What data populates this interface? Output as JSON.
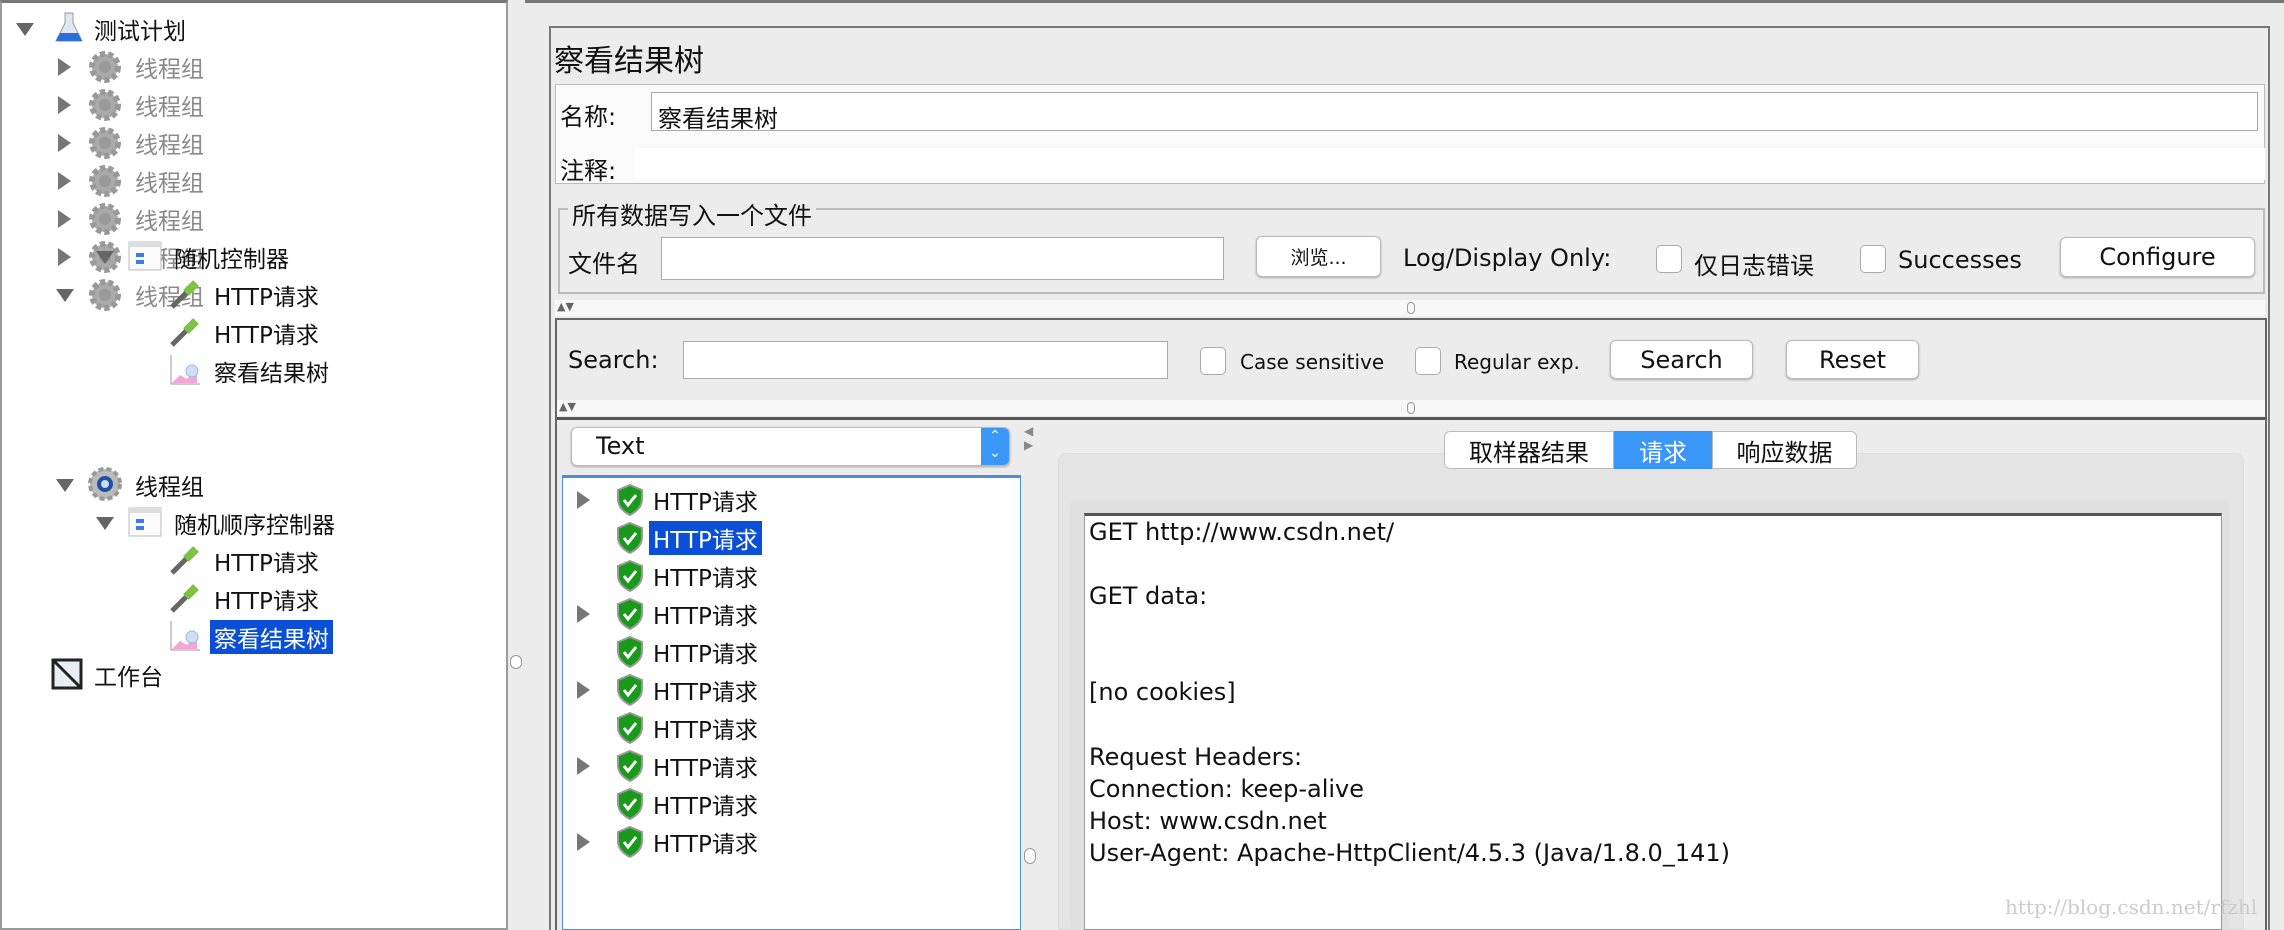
{
  "tree": {
    "root": "测试计划",
    "groups_disabled": [
      "线程组",
      "线程组",
      "线程组",
      "线程组",
      "线程组",
      "线程组",
      "线程组"
    ],
    "controller1": "随机控制器",
    "c1_items": [
      "HTTP请求",
      "HTTP请求",
      "察看结果树"
    ],
    "group_active": "线程组",
    "controller2": "随机顺序控制器",
    "c2_items": [
      "HTTP请求",
      "HTTP请求",
      "察看结果树"
    ],
    "workbench": "工作台"
  },
  "panel": {
    "title": "察看结果树",
    "name_label": "名称:",
    "name_value": "察看结果树",
    "comment_label": "注释:",
    "comment_value": "",
    "file_legend": "所有数据写入一个文件",
    "filename_label": "文件名",
    "filename_value": "",
    "browse": "浏览...",
    "log_display": "Log/Display Only:",
    "errors_only": "仅日志错误",
    "successes": "Successes",
    "configure": "Configure"
  },
  "search": {
    "label": "Search:",
    "value": "",
    "case_sensitive": "Case sensitive",
    "regex": "Regular exp.",
    "search_btn": "Search",
    "reset_btn": "Reset"
  },
  "results": {
    "renderer": "Text",
    "samples": [
      "HTTP请求",
      "HTTP请求",
      "HTTP请求",
      "HTTP请求",
      "HTTP请求",
      "HTTP请求",
      "HTTP请求",
      "HTTP请求",
      "HTTP请求",
      "HTTP请求"
    ],
    "expandable": [
      true,
      false,
      false,
      true,
      false,
      true,
      false,
      true,
      false,
      true
    ],
    "selected_index": 1,
    "tabs": [
      "取样器结果",
      "请求",
      "响应数据"
    ],
    "active_tab": 1,
    "request_text": [
      "GET http://www.csdn.net/",
      "GET data:",
      "[no cookies]",
      "Request Headers:",
      "Connection: keep-alive",
      "Host: www.csdn.net",
      "User-Agent: Apache-HttpClient/4.5.3 (Java/1.8.0_141)"
    ]
  },
  "watermark": "http://blog.csdn.net/rfzhl",
  "colors": {
    "selection": "#0b4fd6",
    "tab_active": "#3b97f7",
    "success_icon": "#1a9a1a"
  }
}
